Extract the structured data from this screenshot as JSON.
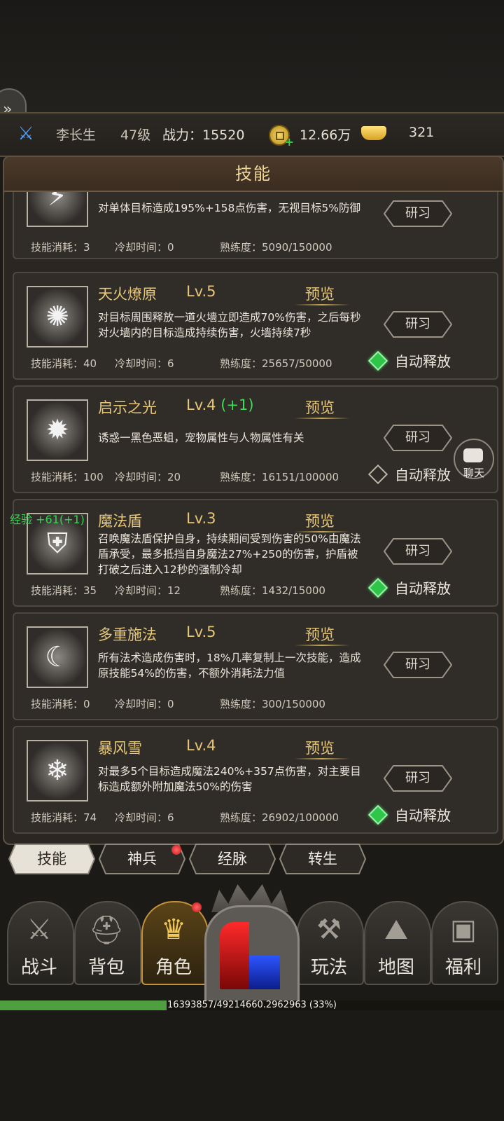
{
  "player": {
    "name": "李长生",
    "level": "47级",
    "power": "战力：15520",
    "silver": "12.66万",
    "gold": "321"
  },
  "panel_title": "技能",
  "skills": [
    {
      "name": "",
      "level": "",
      "preview": "",
      "desc": "对单体目标造成195%+158点伤害，无视目标5%防御",
      "study": "研习",
      "cost": "技能消耗：3",
      "cooldown": "冷却时间：0",
      "proficiency": "熟练度：5090/150000",
      "auto_label": ""
    },
    {
      "name": "天火燎原",
      "level": "Lv.5",
      "preview": "预览",
      "desc": "对目标周围释放一道火墙立即造成70%伤害，之后每秒对火墙内的目标造成持续伤害，火墙持续7秒",
      "study": "研习",
      "cost": "技能消耗：40",
      "cooldown": "冷却时间：6",
      "proficiency": "熟练度：25657/50000",
      "auto_label": "自动释放",
      "auto_on": true
    },
    {
      "name": "启示之光",
      "level": "Lv.4",
      "level_bonus": "(+1)",
      "preview": "预览",
      "desc": "诱惑一黑色恶蛆，宠物属性与人物属性有关",
      "study": "研习",
      "cost": "技能消耗：100",
      "cooldown": "冷却时间：20",
      "proficiency": "熟练度：16151/100000",
      "auto_label": "自动释放",
      "auto_on": false
    },
    {
      "name": "魔法盾",
      "level": "Lv.3",
      "preview": "预览",
      "desc": "召唤魔法盾保护自身，持续期间受到伤害的50%由魔法盾承受，最多抵挡自身魔法27%+250的伤害，护盾被打破之后进入12秒的强制冷却",
      "study": "研习",
      "cost": "技能消耗：35",
      "cooldown": "冷却时间：12",
      "proficiency": "熟练度：1432/15000",
      "auto_label": "自动释放",
      "auto_on": true
    },
    {
      "name": "多重施法",
      "level": "Lv.5",
      "preview": "预览",
      "desc": "所有法术造成伤害时，18%几率复制上一次技能，造成原技能54%的伤害，不额外消耗法力值",
      "study": "研习",
      "cost": "技能消耗：0",
      "cooldown": "冷却时间：0",
      "proficiency": "熟练度：300/150000",
      "auto_label": ""
    },
    {
      "name": "暴风雪",
      "level": "Lv.4",
      "preview": "预览",
      "desc": "对最多5个目标造成魔法240%+357点伤害，对主要目标造成额外附加魔法50%的伤害",
      "study": "研习",
      "cost": "技能消耗：74",
      "cooldown": "冷却时间：6",
      "proficiency": "熟练度：26902/100000",
      "auto_label": "自动释放",
      "auto_on": true
    }
  ],
  "float_exp": "经验 +61(+1)",
  "chat_label": "聊天",
  "subtabs": [
    "技能",
    "神兵",
    "经脉",
    "转生"
  ],
  "nav": [
    "战斗",
    "背包",
    "角色",
    "玩法",
    "地图",
    "福利"
  ],
  "exp": {
    "text": "16393857/49214660.2962963 (33%)",
    "fraction": 0.33
  },
  "colors": {
    "accent_gold": "#e6c77a",
    "auto_on": "#2fc548",
    "bonus_green": "#3ddc5a",
    "exp_fill": "#4f9e3f"
  }
}
